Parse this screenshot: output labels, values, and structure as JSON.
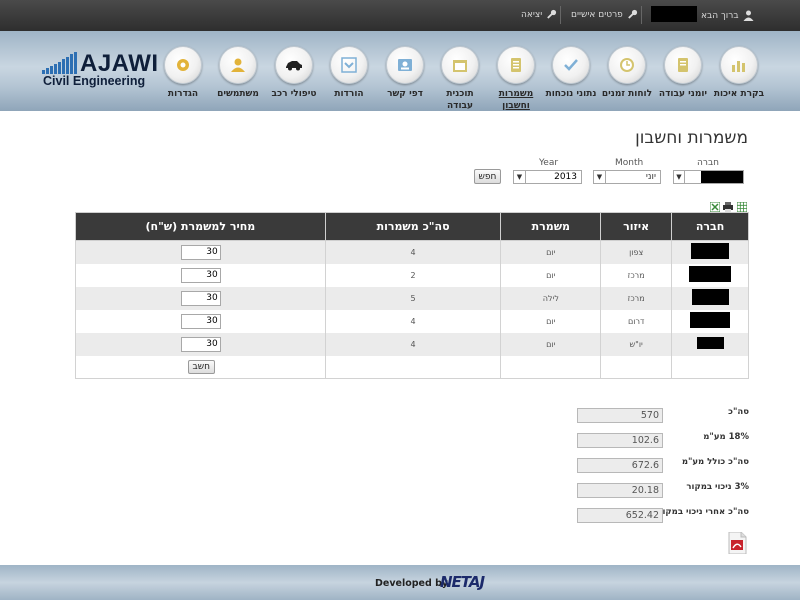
{
  "topbar": {
    "greeting": "ברוך הבא",
    "personal_details": "פרטים אישיים",
    "logout": "יציאה"
  },
  "logo": {
    "main": "AJAWI",
    "sub": "Civil Engineering"
  },
  "nav": [
    {
      "label": "בקרת איכות",
      "icon": "bar-chart-icon"
    },
    {
      "label": "יומני עבודה",
      "icon": "journal-icon"
    },
    {
      "label": "לוחות זמנים",
      "icon": "clock-icon"
    },
    {
      "label": "נתוני נוכחות",
      "icon": "checkmark-icon"
    },
    {
      "label": "משמרות",
      "label2": "וחשבון",
      "icon": "ledger-icon"
    },
    {
      "label": "תוכנית עבודה",
      "icon": "calendar-icon"
    },
    {
      "label": "דפי קשר",
      "icon": "contacts-icon"
    },
    {
      "label": "הורדות",
      "icon": "download-icon"
    },
    {
      "label": "טיפולי רכב",
      "icon": "car-icon"
    },
    {
      "label": "משתמשים",
      "icon": "user-icon"
    },
    {
      "label": "הגדרות",
      "icon": "gear-icon"
    }
  ],
  "page_title": "משמרות וחשבון",
  "filters": {
    "company_label": "חברה",
    "month_label": "Month",
    "month_value": "יוני",
    "year_label": "Year",
    "year_value": "2013",
    "search_button": "חפש"
  },
  "table": {
    "headers": [
      "חברה",
      "איזור",
      "משמרת",
      "סה\"כ משמרות",
      "מחיר למשמרת (ש\"ח)"
    ],
    "rows": [
      {
        "area": "צפון",
        "shift": "יום",
        "total": "4",
        "price": "30"
      },
      {
        "area": "מרכז",
        "shift": "יום",
        "total": "2",
        "price": "30"
      },
      {
        "area": "מרכז",
        "shift": "לילה",
        "total": "5",
        "price": "30"
      },
      {
        "area": "דרום",
        "shift": "יום",
        "total": "4",
        "price": "30"
      },
      {
        "area": "יו\"ש",
        "shift": "יום",
        "total": "4",
        "price": "30"
      }
    ],
    "calc_button": "חשב"
  },
  "totals": [
    {
      "label": "סה\"כ",
      "value": "570"
    },
    {
      "label": "18% מע\"מ",
      "value": "102.6"
    },
    {
      "label": "סה\"כ כולל מע\"מ",
      "value": "672.6"
    },
    {
      "label": "3% ניכוי במקור",
      "value": "20.18"
    },
    {
      "label": "סה\"כ אחרי ניכוי במקור",
      "value": "652.42"
    }
  ],
  "footer": {
    "developed_by": "Developed by",
    "brand": "NETAJ"
  }
}
